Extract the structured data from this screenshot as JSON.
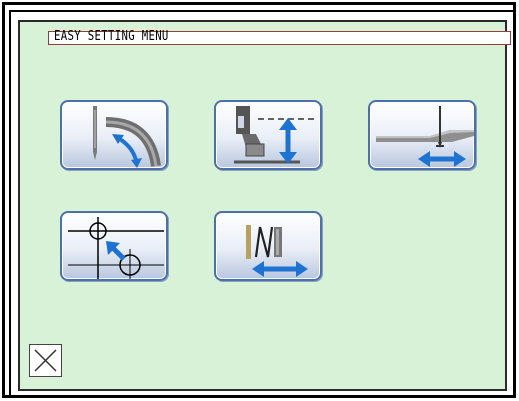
{
  "screen": {
    "title": "EASY SETTING MENU"
  },
  "menu_buttons": [
    {
      "icon": "needle-rotation-icon"
    },
    {
      "icon": "presser-height-icon"
    },
    {
      "icon": "feed-position-icon"
    },
    {
      "icon": "origin-offset-icon"
    },
    {
      "icon": "stitch-width-icon"
    }
  ],
  "footer": {
    "close_icon": "close-icon"
  },
  "colors": {
    "panel_bg": "#d8f2d8",
    "button_border": "#4e70a8",
    "arrow_blue": "#1e73d2",
    "part_gray": "#6f6f6f"
  }
}
